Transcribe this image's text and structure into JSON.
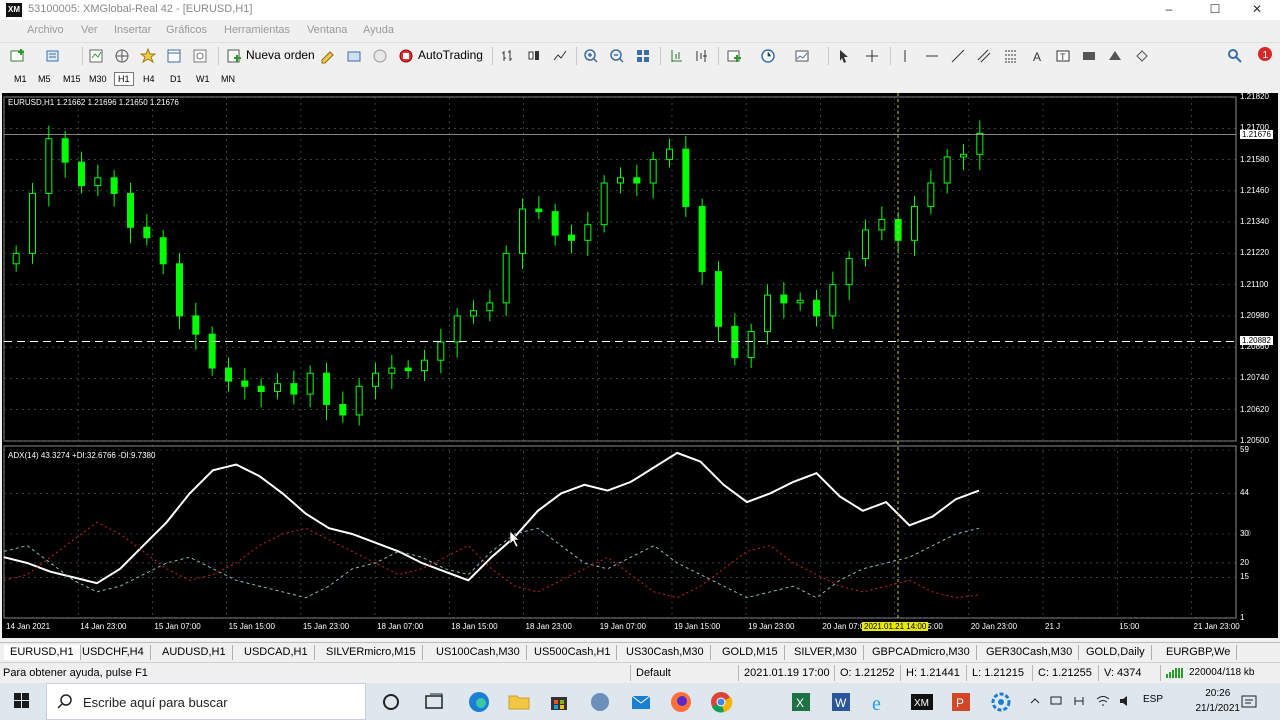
{
  "window": {
    "icon_text": "XM",
    "title": "53100005: XMGlobal-Real 42 - [EURUSD,H1]",
    "minimize": "–",
    "maximize": "☐",
    "close": "✕"
  },
  "menu": [
    "Archivo",
    "Ver",
    "Insertar",
    "Gráficos",
    "Herramientas",
    "Ventana",
    "Ayuda"
  ],
  "toolbar": {
    "new_order": "Nueva orden",
    "autotrading": "AutoTrading",
    "notification_count": "1"
  },
  "timeframes": {
    "items": [
      "M1",
      "M5",
      "M15",
      "M30",
      "H1",
      "H4",
      "D1",
      "W1",
      "MN"
    ],
    "active": "H1"
  },
  "chart": {
    "info": "EURUSD,H1  1.21662 1.21696 1.21650 1.21676",
    "price_axis": [
      "1.21820",
      "1.21700",
      "1.21580",
      "1.21460",
      "1.21340",
      "1.21220",
      "1.21100",
      "1.20980",
      "1.20860",
      "1.20740",
      "1.20620",
      "1.20500"
    ],
    "bid_label": "1.21676",
    "hline_label": "1.20882",
    "indicator_info": "ADX(14) 43.3274 +DI:32.6766 -DI:9.7380",
    "indicator_axis": [
      "59",
      "44",
      "30",
      "20",
      "15",
      "1"
    ],
    "indicator_level_label": "30",
    "time_axis": [
      "14 Jan 2021",
      "14 Jan 23:00",
      "15 Jan 07:00",
      "15 Jan 15:00",
      "15 Jan 23:00",
      "18 Jan 07:00",
      "18 Jan 15:00",
      "18 Jan 23:00",
      "19 Jan 07:00",
      "19 Jan 15:00",
      "19 Jan 23:00",
      "20 Jan 07:00",
      "20 Jan 15:00",
      "20 Jan 23:00",
      "21 J",
      "15:00",
      "21 Jan 23:00"
    ],
    "crosshair_time": "2021.01.21 14:00",
    "colors": {
      "background": "#000000",
      "candle": "#00ff00",
      "grid": "#5a6a7a",
      "adx": "#ffffff",
      "plus_di": "#8fb8b8",
      "minus_di": "#cc2222",
      "crosshair": "#cccc33"
    }
  },
  "chart_data": [
    {
      "type": "candlestick",
      "symbol": "EURUSD",
      "timeframe": "H1",
      "ylim": [
        1.205,
        1.2182
      ],
      "close_series_approx": [
        1.2122,
        1.2145,
        1.2166,
        1.2157,
        1.2148,
        1.2151,
        1.2145,
        1.2132,
        1.2128,
        1.2118,
        1.2098,
        1.2091,
        1.2078,
        1.2073,
        1.2071,
        1.2069,
        1.2072,
        1.2068,
        1.2076,
        1.2064,
        1.206,
        1.2071,
        1.2076,
        1.2078,
        1.2077,
        1.2081,
        1.2088,
        1.2098,
        1.21,
        1.2103,
        1.2122,
        1.2139,
        1.2138,
        1.2129,
        1.2127,
        1.2133,
        1.2149,
        1.2151,
        1.2149,
        1.2158,
        1.2162,
        1.214,
        1.2115,
        1.2094,
        1.2082,
        1.2092,
        1.2106,
        1.2103,
        1.2104,
        1.2098,
        1.211,
        1.212,
        1.2131,
        1.2135,
        1.2127,
        1.214,
        1.2149,
        1.2159,
        1.216,
        1.2168
      ]
    },
    {
      "type": "line",
      "name": "ADX(14)",
      "ylim": [
        1,
        59
      ],
      "series": [
        {
          "name": "ADX",
          "values": [
            22,
            20,
            17,
            15,
            13,
            18,
            26,
            34,
            44,
            52,
            54,
            50,
            44,
            37,
            32,
            30,
            27,
            24,
            20,
            17,
            14,
            22,
            29,
            38,
            44,
            47,
            45,
            48,
            53,
            58,
            55,
            47,
            41,
            44,
            48,
            51,
            43,
            38,
            41,
            33,
            36,
            42,
            45
          ]
        },
        {
          "name": "+DI",
          "values": [
            24,
            26,
            20,
            14,
            10,
            12,
            16,
            20,
            22,
            18,
            14,
            12,
            10,
            8,
            12,
            18,
            20,
            24,
            22,
            18,
            16,
            24,
            30,
            32,
            26,
            20,
            18,
            22,
            26,
            20,
            16,
            12,
            8,
            10,
            12,
            8,
            14,
            18,
            20,
            22,
            26,
            30,
            32
          ]
        },
        {
          "name": "-DI",
          "values": [
            14,
            16,
            22,
            28,
            34,
            30,
            24,
            18,
            14,
            16,
            20,
            26,
            30,
            32,
            28,
            24,
            20,
            16,
            18,
            22,
            26,
            18,
            12,
            10,
            14,
            18,
            22,
            16,
            10,
            8,
            12,
            18,
            24,
            26,
            20,
            16,
            12,
            10,
            12,
            14,
            10,
            8,
            9
          ]
        }
      ]
    }
  ],
  "symbol_tabs": [
    "EURUSD,H1",
    "USDCHF,H4",
    "AUDUSD,H1",
    "USDCAD,H1",
    "SILVERmicro,M15",
    "US100Cash,M30",
    "US500Cash,H1",
    "US30Cash,M30",
    "GOLD,M15",
    "SILVER,M30",
    "GBPCADmicro,M30",
    "GER30Cash,M30",
    "GOLD,Daily",
    "EURGBP,We"
  ],
  "status": {
    "help": "Para obtener ayuda, pulse F1",
    "profile": "Default",
    "datetime": "2021.01.19 17:00",
    "open": "O: 1.21252",
    "high": "H: 1.21441",
    "low": "L: 1.21215",
    "close": "C: 1.21255",
    "volume": "V: 4374",
    "traffic": "220004/118 kb"
  },
  "taskbar": {
    "search_placeholder": "Escribe aquí para buscar",
    "lang": "ESP",
    "time": "20:26",
    "date": "21/1/2021"
  }
}
